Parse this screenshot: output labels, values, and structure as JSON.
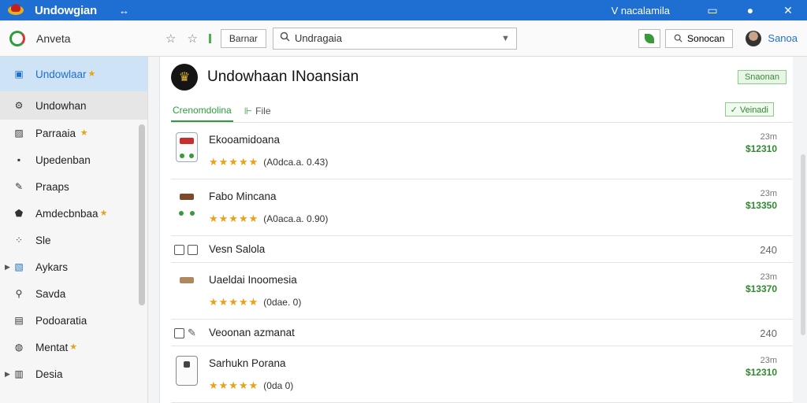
{
  "titlebar": {
    "title": "Undowgian",
    "tab_button": "↔",
    "right_label": "V nacalamila",
    "win_buttons": [
      "▭",
      "●",
      "✕"
    ]
  },
  "toolbar": {
    "app_name": "Anveta",
    "address_button": "Barnar",
    "search_value": "Undragaia",
    "search_button": "Sonocan",
    "user_name": "Sanoa"
  },
  "sidebar": {
    "items": [
      {
        "label": "Undowlaar",
        "star": true
      },
      {
        "label": "Undowhan",
        "star": false
      },
      {
        "label": "Parraaia",
        "star": true
      },
      {
        "label": "Upedenban",
        "star": false
      },
      {
        "label": "Praaps",
        "star": false
      },
      {
        "label": "Amdecbnbaa",
        "star": true
      },
      {
        "label": "Sle",
        "star": false
      },
      {
        "label": "Aykars",
        "star": false,
        "expandable": true
      },
      {
        "label": "Savda",
        "star": false
      },
      {
        "label": "Podoaratia",
        "star": false
      },
      {
        "label": "Mentat",
        "star": true
      },
      {
        "label": "Desia",
        "star": false,
        "expandable": true
      }
    ]
  },
  "main": {
    "title": "Undowhaan INoansian",
    "header_button": "Snaonan",
    "tabs": [
      "Crenomdolina",
      "File"
    ],
    "view_button": "✓ Veinadi",
    "rows": [
      {
        "type": "big",
        "title": "Ekooamidoana",
        "stars": "★★★★★",
        "rating": "(A0dca.a. 0.43)",
        "time": "23m",
        "price": "$12310"
      },
      {
        "type": "big",
        "title": "Fabo Mincana",
        "stars": "★★★★★",
        "rating": "(A0aca.a. 0.90)",
        "time": "23m",
        "price": "$13350"
      },
      {
        "type": "small",
        "title": "Vesn Salola",
        "count": "240"
      },
      {
        "type": "big",
        "title": "Uaeldai Inoomesia",
        "stars": "★★★★★",
        "rating": "(0dae. 0)",
        "time": "23m",
        "price": "$13370"
      },
      {
        "type": "small",
        "title": "Veoonan azmanat",
        "count": "240"
      },
      {
        "type": "big",
        "title": "Sarhukn Porana",
        "stars": "★★★★★",
        "rating": "(0da 0)",
        "time": "23m",
        "price": "$12310"
      }
    ]
  },
  "colors": {
    "accent": "#1e6fd1",
    "green": "#2e9c3c",
    "star": "#e8a21a"
  }
}
